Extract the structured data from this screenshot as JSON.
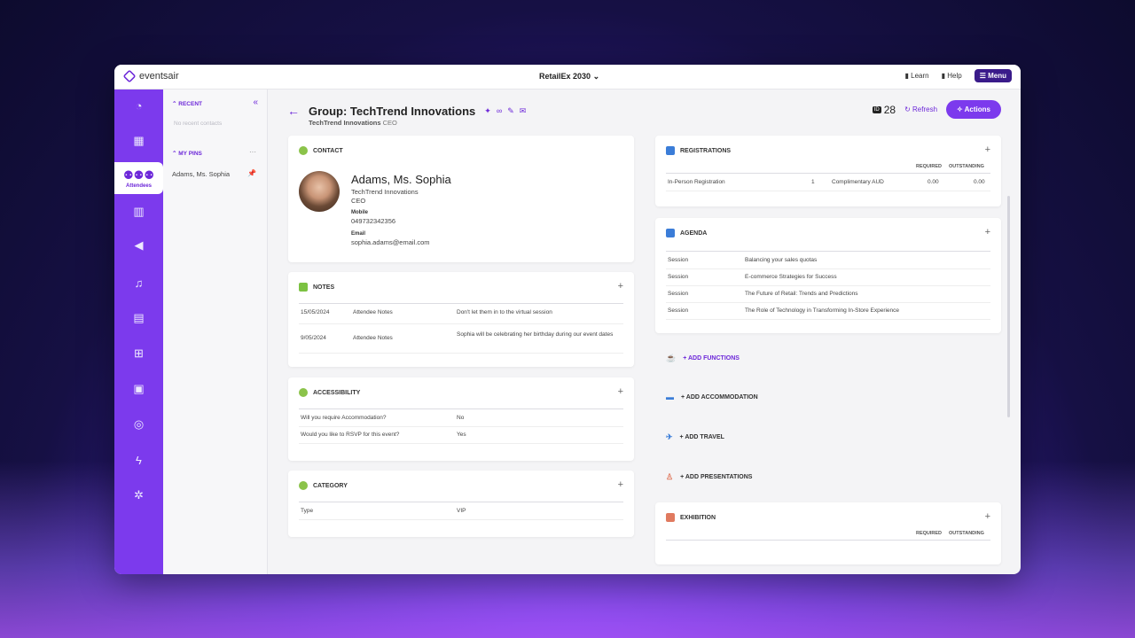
{
  "app": {
    "logo_text": "eventsair",
    "event": "RetailEx 2030",
    "learn": "Learn",
    "help": "Help",
    "menu": "Menu"
  },
  "rail": {
    "active_label": "Attendees"
  },
  "side": {
    "recent": "RECENT",
    "no_recent": "No recent contacts",
    "my_pins": "MY PINS",
    "pin_item": "Adams, Ms. Sophia"
  },
  "header": {
    "title": "Group: TechTrend Innovations",
    "company": "TechTrend Innovations",
    "role": "CEO",
    "id_tag": "ID",
    "id_value": "28",
    "refresh": "Refresh",
    "actions": "Actions"
  },
  "contact": {
    "heading": "CONTACT",
    "name": "Adams, Ms. Sophia",
    "company": "TechTrend Innovations",
    "title": "CEO",
    "mobile_label": "Mobile",
    "mobile": "049732342356",
    "email_label": "Email",
    "email": "sophia.adams@email.com"
  },
  "notes": {
    "heading": "NOTES",
    "rows": [
      {
        "date": "15/05/2024",
        "type": "Attendee Notes",
        "text": "Don't let them in to the virtual session"
      },
      {
        "date": "9/05/2024",
        "type": "Attendee Notes",
        "text": "Sophia will be celebrating her birthday during our event dates"
      }
    ]
  },
  "accessibility": {
    "heading": "ACCESSIBILITY",
    "rows": [
      {
        "q": "Will you require Accommodation?",
        "a": "No"
      },
      {
        "q": "Would you like to RSVP for this event?",
        "a": "Yes"
      }
    ]
  },
  "category": {
    "heading": "CATEGORY",
    "rows": [
      {
        "q": "Type",
        "a": "VIP"
      }
    ]
  },
  "registrations": {
    "heading": "REGISTRATIONS",
    "col_required": "REQUIRED",
    "col_outstanding": "OUTSTANDING",
    "rows": [
      {
        "name": "In-Person Registration",
        "qty": "1",
        "type": "Complimentary AUD",
        "required": "0.00",
        "outstanding": "0.00"
      }
    ]
  },
  "agenda": {
    "heading": "AGENDA",
    "rows": [
      {
        "kind": "Session",
        "title": "Balancing your sales quotas"
      },
      {
        "kind": "Session",
        "title": "E-commerce Strategies for Success"
      },
      {
        "kind": "Session",
        "title": "The Future of Retail: Trends and Predictions"
      },
      {
        "kind": "Session",
        "title": "The Role of Technology in Transforming In-Store Experience"
      }
    ]
  },
  "adds": {
    "functions": "+ ADD FUNCTIONS",
    "accommodation": "+ ADD ACCOMMODATION",
    "travel": "+ ADD TRAVEL",
    "presentations": "+ ADD PRESENTATIONS"
  },
  "exhibition": {
    "heading": "EXHIBITION",
    "col_required": "REQUIRED",
    "col_outstanding": "OUTSTANDING"
  },
  "colors": {
    "accent": "#7c3aed",
    "rail": "#7c3aed",
    "menu": "#3a1b8a"
  }
}
